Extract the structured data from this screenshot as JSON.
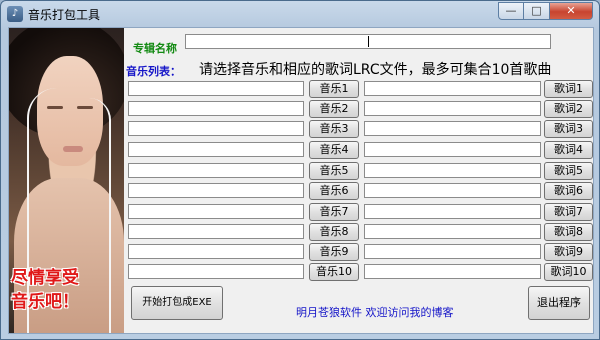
{
  "window": {
    "title": "音乐打包工具",
    "icon": "music-app-icon",
    "controls": {
      "minimize": "—",
      "maximize": "□",
      "close": "✕"
    }
  },
  "photo": {
    "slogan_line1": "尽情享受",
    "slogan_line2": "音乐吧！"
  },
  "album": {
    "label": "专辑名称",
    "value": ""
  },
  "music_list": {
    "label": "音乐列表：",
    "hint": "请选择音乐和相应的歌词LRC文件，最多可集合10首歌曲"
  },
  "rows": [
    {
      "music_value": "",
      "music_btn": "音乐1",
      "lyric_value": "",
      "lyric_btn": "歌词1"
    },
    {
      "music_value": "",
      "music_btn": "音乐2",
      "lyric_value": "",
      "lyric_btn": "歌词2"
    },
    {
      "music_value": "",
      "music_btn": "音乐3",
      "lyric_value": "",
      "lyric_btn": "歌词3"
    },
    {
      "music_value": "",
      "music_btn": "音乐4",
      "lyric_value": "",
      "lyric_btn": "歌词4"
    },
    {
      "music_value": "",
      "music_btn": "音乐5",
      "lyric_value": "",
      "lyric_btn": "歌词5"
    },
    {
      "music_value": "",
      "music_btn": "音乐6",
      "lyric_value": "",
      "lyric_btn": "歌词6"
    },
    {
      "music_value": "",
      "music_btn": "音乐7",
      "lyric_value": "",
      "lyric_btn": "歌词7"
    },
    {
      "music_value": "",
      "music_btn": "音乐8",
      "lyric_value": "",
      "lyric_btn": "歌词8"
    },
    {
      "music_value": "",
      "music_btn": "音乐9",
      "lyric_value": "",
      "lyric_btn": "歌词9"
    },
    {
      "music_value": "",
      "music_btn": "音乐10",
      "lyric_value": "",
      "lyric_btn": "歌词10"
    }
  ],
  "actions": {
    "pack": "开始打包成EXE",
    "exit": "退出程序"
  },
  "footer": "明月苍狼软件 欢迎访问我的博客",
  "colors": {
    "green_label": "#138a13",
    "blue_label": "#1414c8",
    "slogan": "#e01818"
  }
}
